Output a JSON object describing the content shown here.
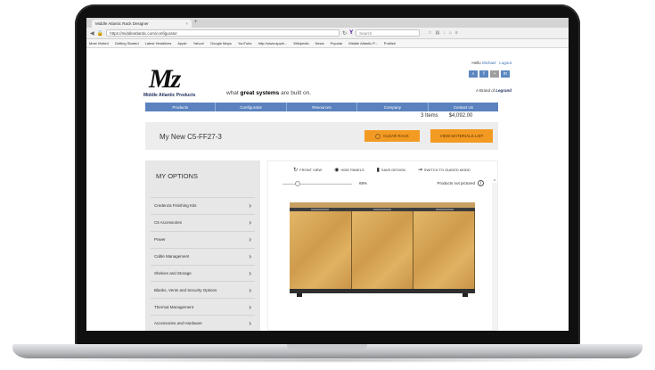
{
  "browser": {
    "tab_title": "Middle Atlantic Rack Designer",
    "tab_close": "×",
    "new_tab": "+",
    "url": "https://middleatlantic.com/configurator",
    "search_placeholder": "Search",
    "bookmarks": [
      "Most Visited",
      "Getting Started",
      "Latest Headlines",
      "Apple",
      "Yahoo!",
      "Google Maps",
      "YouTube",
      "http://www.apple...",
      "Wikipedia",
      "News",
      "Popular",
      "Middle Atlantic P...",
      "Publish"
    ]
  },
  "header": {
    "hello": "Hello",
    "user": "Michael",
    "logout": "Logout",
    "logo_mark": "Mz",
    "company": "Middle Atlantic Products",
    "tagline_pre": "what ",
    "tagline_bold": "great systems",
    "tagline_post": " are built on.",
    "brand_prefix": "A Brand of",
    "brand": "Legrand"
  },
  "nav": [
    "Products",
    "Configurator",
    "Resources",
    "Company",
    "Contact Us"
  ],
  "cart": {
    "items": "3 Items",
    "total": "$4,092.00"
  },
  "configurator": {
    "title": "My New C5-FF27-3",
    "clear_label": "CLEAR RACK",
    "view_label": "VIEW MATERIALS LIST"
  },
  "sidebar": {
    "title": "MY OPTIONS",
    "items": [
      "Credenza Finishing Kits",
      "C5 Accessories",
      "Power",
      "Cable Management",
      "Shelves and Storage",
      "Blanks, Vents and Security Options",
      "Thermal Management",
      "Accessories and Hardware"
    ]
  },
  "viewer": {
    "front_view": "FRONT VIEW",
    "hide_panels": "HIDE PANELS",
    "save_design": "SAVE DESIGN",
    "guided_mode": "SWITCH TO GUIDED MODE",
    "zoom": "68%",
    "not_pictured": "Products not pictured"
  }
}
